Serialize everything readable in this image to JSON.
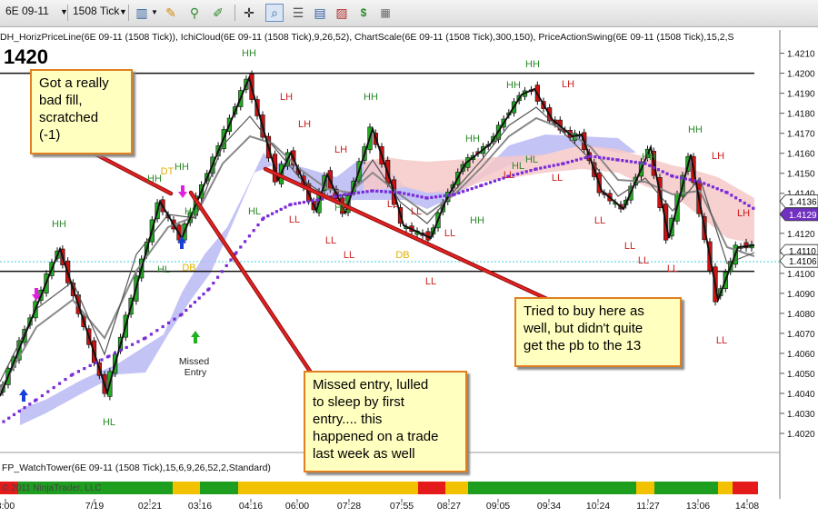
{
  "toolbar": {
    "instrument": "6E 09-11",
    "interval": "1508 Tick",
    "icons": [
      "bar-chart-icon",
      "pencil-icon",
      "pin-icon",
      "brush-icon",
      "crosshair-icon",
      "zoom-icon",
      "properties-icon",
      "chart-trader-icon",
      "performance-icon",
      "strategy-icon",
      "more-icon"
    ]
  },
  "chart": {
    "indicator_header": "DH_HorizPriceLine(6E 09-11 (1508 Tick)), IchiCloud(6E 09-11 (1508 Tick),9,26,52), ChartScale(6E 09-11 (1508 Tick),300,150), PriceActionSwing(6E 09-11 (1508 Tick),15,2,S",
    "bar_count_label": "1420",
    "price_axis": {
      "labels": [
        "1.4210",
        "1.4200",
        "1.4190",
        "1.4180",
        "1.4170",
        "1.4160",
        "1.4150",
        "1.4140",
        "1.4130",
        "1.4120",
        "1.4110",
        "1.4100",
        "1.4090",
        "1.4080",
        "1.4070",
        "1.4060",
        "1.4050",
        "1.4040",
        "1.4030",
        "1.4020"
      ],
      "min": 1.4015,
      "max": 1.4213
    },
    "price_tags": [
      {
        "label": "1.4136",
        "color": "#ffffff",
        "price": 1.4136
      },
      {
        "label": "1.4129",
        "color": "#7030c0",
        "price": 1.41295
      },
      {
        "label": "1.4110",
        "color": "#ffffff",
        "price": 1.41112
      },
      {
        "label": "1.4106",
        "color": "#ffffff",
        "price": 1.41062
      }
    ],
    "time_axis": [
      "8:00",
      "7/19",
      "02:21",
      "03:16",
      "04:16",
      "06:00",
      "07:28",
      "07:55",
      "08:27",
      "09:05",
      "09:34",
      "10:24",
      "11:27",
      "13:06",
      "14:08"
    ],
    "horizontal_lines": [
      1.42,
      1.4101
    ],
    "swing_labels": [
      {
        "text": "HH",
        "color": "#2a8a2a"
      },
      {
        "text": "HH",
        "color": "#2a8a2a"
      },
      {
        "text": "HH",
        "color": "#2a8a2a"
      },
      {
        "text": "HH",
        "color": "#2a8a2a"
      },
      {
        "text": "HH",
        "color": "#2a8a2a"
      },
      {
        "text": "HH",
        "color": "#2a8a2a"
      },
      {
        "text": "HH",
        "color": "#2a8a2a"
      },
      {
        "text": "HH",
        "color": "#2a8a2a"
      },
      {
        "text": "HH",
        "color": "#2a8a2a"
      },
      {
        "text": "HH",
        "color": "#2a8a2a"
      },
      {
        "text": "HH",
        "color": "#2a8a2a"
      },
      {
        "text": "HL",
        "color": "#2a8a2a"
      },
      {
        "text": "HL",
        "color": "#2a8a2a"
      },
      {
        "text": "HL",
        "color": "#2a8a2a"
      },
      {
        "text": "HL",
        "color": "#2a8a2a"
      },
      {
        "text": "HL",
        "color": "#2a8a2a"
      },
      {
        "text": "HL",
        "color": "#2a8a2a"
      },
      {
        "text": "HL",
        "color": "#2a8a2a"
      },
      {
        "text": "LH",
        "color": "#cc2020"
      },
      {
        "text": "LH",
        "color": "#cc2020"
      },
      {
        "text": "LH",
        "color": "#cc2020"
      },
      {
        "text": "LH",
        "color": "#cc2020"
      },
      {
        "text": "LH",
        "color": "#cc2020"
      },
      {
        "text": "LH",
        "color": "#cc2020"
      },
      {
        "text": "LL",
        "color": "#cc2020"
      },
      {
        "text": "LL",
        "color": "#cc2020"
      },
      {
        "text": "LL",
        "color": "#cc2020"
      },
      {
        "text": "LL",
        "color": "#cc2020"
      },
      {
        "text": "LL",
        "color": "#cc2020"
      },
      {
        "text": "LL",
        "color": "#cc2020"
      },
      {
        "text": "LL",
        "color": "#cc2020"
      },
      {
        "text": "LL",
        "color": "#cc2020"
      },
      {
        "text": "LL",
        "color": "#cc2020"
      },
      {
        "text": "LL",
        "color": "#cc2020"
      },
      {
        "text": "LL",
        "color": "#cc2020"
      },
      {
        "text": "LL",
        "color": "#cc2020"
      },
      {
        "text": "LL",
        "color": "#cc2020"
      },
      {
        "text": "LL",
        "color": "#cc2020"
      },
      {
        "text": "LL",
        "color": "#cc2020"
      },
      {
        "text": "DT",
        "color": "#e0b000"
      },
      {
        "text": "DB",
        "color": "#e0b000"
      },
      {
        "text": "DB",
        "color": "#e0b000"
      }
    ],
    "missed_entry_label": "Missed\nEntry",
    "indicator_panel_label": "FP_WatchTower(6E 09-11 (1508 Tick),15,6,9,26,52,2,Standard)",
    "copyright": "© 2011 NinjaTrader, LLC",
    "colors": {
      "up": "#22aa22",
      "down": "#cc1111",
      "cloud_bull": "#b8b8f4",
      "cloud_bear": "#f6c8c8",
      "kijun": "#7a2bd8",
      "watchtower_up": "#1e9e1e",
      "watchtower_mid": "#f2c200",
      "watchtower_down": "#e51a1a"
    }
  },
  "callouts": [
    {
      "text": "Got a really\nbad fill,\nscratched\n(-1)"
    },
    {
      "text": "Tried to buy here as\nwell, but didn't quite\nget the pb to the 13"
    },
    {
      "text": "Missed entry, lulled\nto sleep by first\nentry.... this\nhappened on a trade\nlast week as well"
    }
  ]
}
